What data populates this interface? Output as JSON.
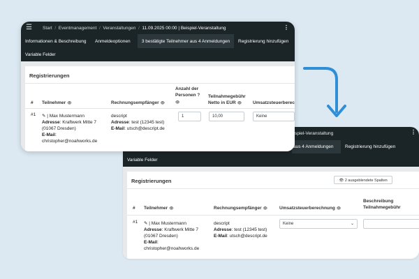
{
  "app": {
    "breadcrumb": [
      "Start",
      "Eventmanagement",
      "Veranstaltungen",
      "11.09.2025 00:00 | Beispiel-Veranstaltung"
    ],
    "breadcrumb_sep": "/",
    "tabs": [
      "Informationen & Beschreibung",
      "Anmeldeoptionen",
      "3 bestätigte Teilnehmer aus 4 Anmeldungen",
      "Registrierung hinzufügen",
      "Variable Felder"
    ],
    "back_title_fragment": "spiel-Veranstaltung",
    "back_tab_fragment": "aus 4 Anmeldungen"
  },
  "section": {
    "title": "Registrierungen",
    "hidden_columns_button": "2 ausgeblendete Spalten"
  },
  "columns": {
    "num": "#",
    "participant": "Teilnehmer",
    "billing": "Rechnungsempfänger",
    "persons": [
      "Anzahl der",
      "Personen"
    ],
    "fee": [
      "Teilnahmegebühr",
      "Netto in EUR"
    ],
    "vat": "Umsatzsteuerberechnung",
    "vat_truncated": "Umsatzsteuerberechnu",
    "desc": [
      "Beschreibung",
      "Teilnahmegebühr"
    ]
  },
  "row": {
    "num": "#1",
    "name": "| Max Mustermann",
    "address_label": "Adresse",
    "address_value_1": "Kraftwerk Mitte 7",
    "address_value_2": "(01067 Dresden)",
    "email_label": "E-Mail",
    "email_value": "christopher@noahworks.de",
    "billing_name": "descript",
    "billing_address_label": "Adresse",
    "billing_address_value": "test (12345 test)",
    "billing_email_label": "E-Mail",
    "billing_email_value": "utsch@descript.de",
    "persons": "1",
    "fee": "10,00",
    "vat": "Keine"
  },
  "colors": {
    "navbar": "#1b2528",
    "active_tab": "#2c373b",
    "arrow": "#2f8fd6",
    "background": "#dce9f2"
  }
}
